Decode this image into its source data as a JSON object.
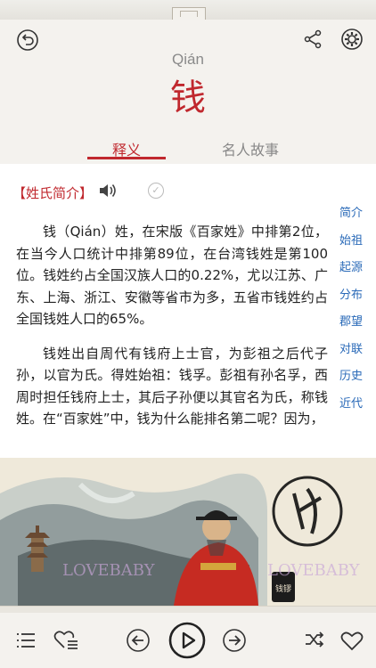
{
  "header": {
    "pinyin": "Qián",
    "character": "钱",
    "tabs": [
      {
        "label": "释义",
        "active": true
      },
      {
        "label": "名人故事",
        "active": false
      }
    ]
  },
  "toolbar": {
    "back_icon": "back-circle-icon",
    "share_icon": "share-icon",
    "settings_icon": "gear-icon"
  },
  "content": {
    "section_title": "【姓氏简介】",
    "paragraphs": [
      "钱（Qián）姓，在宋版《百家姓》中排第2位，在当今人口统计中排第89位，在台湾钱姓是第100位。钱姓约占全国汉族人口的0.22%，尤以江苏、广东、上海、浙江、安徽等省市为多，五省市钱姓约占全国钱姓人口的65%。",
      "钱姓出自周代有钱府上士官，为彭祖之后代子孙，以官为氏。得姓始祖：钱孚。彭祖有孙名孚，西周时担任钱府上士，其后子孙便以其官名为氏，称钱姓。在“百家姓”中，钱为什么能排名第二呢？因为，"
    ]
  },
  "sidenav": {
    "items": [
      "简介",
      "始祖",
      "起源",
      "分布",
      "郡望",
      "对联",
      "历史",
      "近代"
    ]
  },
  "banner": {
    "watermark": "LOVEBABY",
    "seal_text": "钱镠"
  },
  "colors": {
    "accent": "#c0282e",
    "link": "#2a6ab8"
  }
}
